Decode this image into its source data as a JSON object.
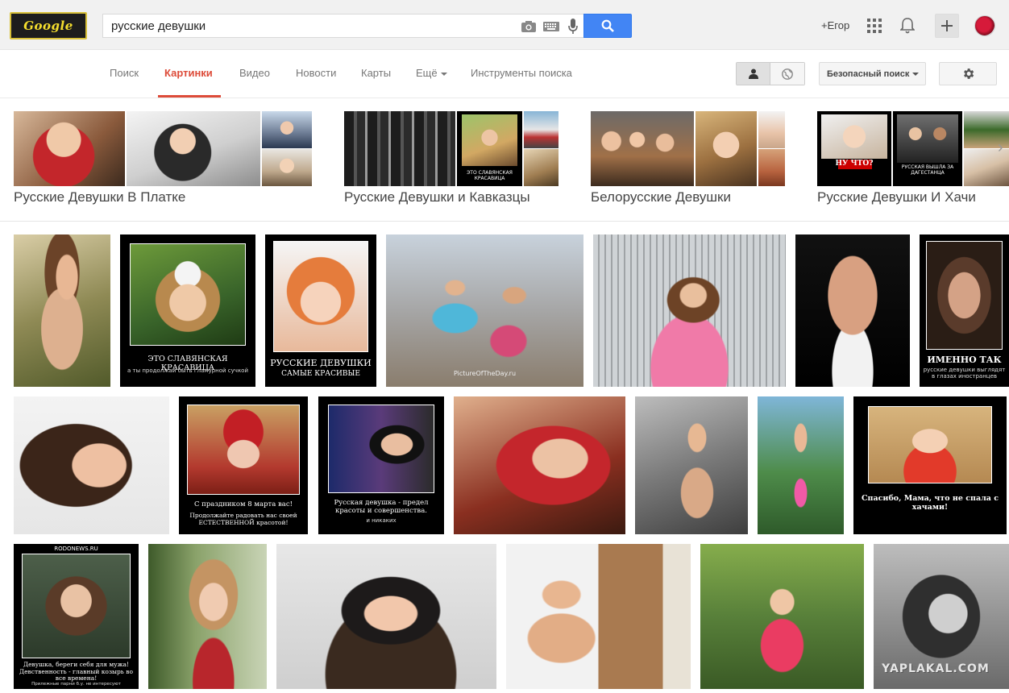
{
  "header": {
    "logo_text": "Google",
    "search_value": "русские девушки",
    "user_link": "+Егор",
    "icons": [
      "camera-icon",
      "keyboard-icon",
      "microphone-icon",
      "search-icon",
      "apps-icon",
      "bell-icon",
      "plus-icon"
    ]
  },
  "nav": {
    "tabs": [
      {
        "label": "Поиск"
      },
      {
        "label": "Картинки"
      },
      {
        "label": "Видео"
      },
      {
        "label": "Новости"
      },
      {
        "label": "Карты"
      },
      {
        "label": "Ещё"
      },
      {
        "label": "Инструменты поиска"
      }
    ],
    "active_tab": "Картинки",
    "safe_search": "Безопасный поиск",
    "accent_color": "#dd4b39"
  },
  "related": [
    {
      "label": "Русские Девушки В Платке"
    },
    {
      "label": "Русские Девушки и Кавказцы"
    },
    {
      "label": "Белорусские Девушки"
    },
    {
      "label": "Русские Девушки И Хачи"
    }
  ],
  "related_captions": {
    "kavkaz": "ЭТО СЛАВЯНСКАЯ КРАСАВИЦА",
    "dagestan": "РУССКАЯ ВЫШЛА ЗА ДАГЕСТАНЦА",
    "nu_chto": "НУ ЧТО?"
  },
  "results": {
    "row1": {
      "venok_title": "ЭТО СЛАВЯНСКАЯ КРАСАВИЦА",
      "venok_sub": "а ты продолжай быть гламурной сучкой",
      "krasivye_title": "РУССКИЕ ДЕВУШКИ",
      "krasivye_sub": "САМЫЕ КРАСИВЫЕ",
      "imenno_title": "ИМЕННО ТАК",
      "imenno_sub": "русские девушки выглядят в глазах иностранцев",
      "street_watermark": "PictureOfTheDay.ru"
    },
    "row2": {
      "march_title": "С праздником 8 марта вас!",
      "march_sub": "Продолжайте радовать нас своей ЕСТЕСТВЕННОЙ красотой!",
      "predel_title": "Русская девушка - предел красоты и совершенства.",
      "predel_sub": "и никаких",
      "mama_title": "Спасибо, Мама, что не спала с хачами!"
    },
    "row3": {
      "rodonews_top": "RODONEWS.RU",
      "beregi_title": "Девушка, береги себя для мужа! Девственность - главный козырь во все времена!",
      "beregi_sub": "Прилежные парни б.у. не интересуют"
    }
  },
  "watermark": "YAPLAKAL.COM"
}
